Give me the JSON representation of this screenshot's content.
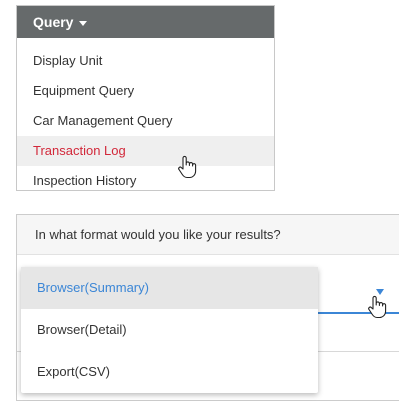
{
  "query_menu": {
    "title": "Query",
    "items": [
      {
        "label": "Display Unit"
      },
      {
        "label": "Equipment Query"
      },
      {
        "label": "Car Management Query"
      },
      {
        "label": "Transaction Log",
        "active": true
      },
      {
        "label": "Inspection History"
      }
    ]
  },
  "results_format": {
    "question": "In what format would you like your results?",
    "options": [
      {
        "label": "Browser(Summary)",
        "selected": true
      },
      {
        "label": "Browser(Detail)"
      },
      {
        "label": "Export(CSV)"
      }
    ]
  },
  "colors": {
    "menu_header": "#666a6b",
    "active_item_text": "#d2283a",
    "selected_option_text": "#3b86d6"
  },
  "icons": [
    "caret-down-icon",
    "dropdown-arrow-icon",
    "hand-cursor-icon"
  ]
}
